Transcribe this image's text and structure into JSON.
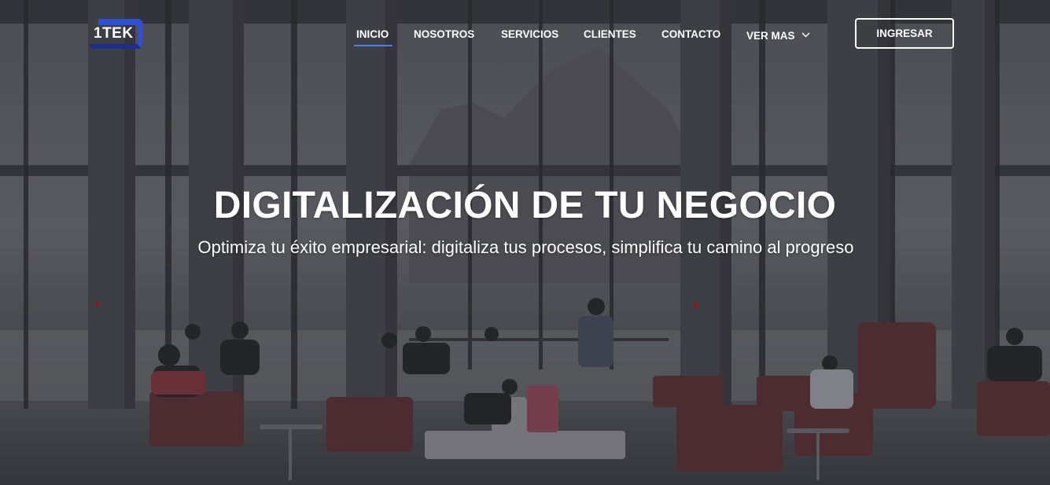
{
  "brand": {
    "logo_text": "1TEK",
    "accent_color": "#2f4fd1"
  },
  "nav": {
    "items": [
      {
        "label": "INICIO",
        "active": true
      },
      {
        "label": "NOSOTROS",
        "active": false
      },
      {
        "label": "SERVICIOS",
        "active": false
      },
      {
        "label": "CLIENTES",
        "active": false
      },
      {
        "label": "CONTACTO",
        "active": false
      },
      {
        "label": "VER MAS",
        "active": false,
        "has_dropdown": true
      }
    ],
    "dropdown_icon": "chevron-down-icon",
    "active_color": "#4f7cf0",
    "login_label": "INGRESAR"
  },
  "hero": {
    "title": "DIGITALIZACIÓN DE TU NEGOCIO",
    "subtitle": "Optimiza tu éxito empresarial: digitaliza tus procesos, simplifica tu camino al progreso",
    "background_description_icon": "office-lobby-photo"
  }
}
